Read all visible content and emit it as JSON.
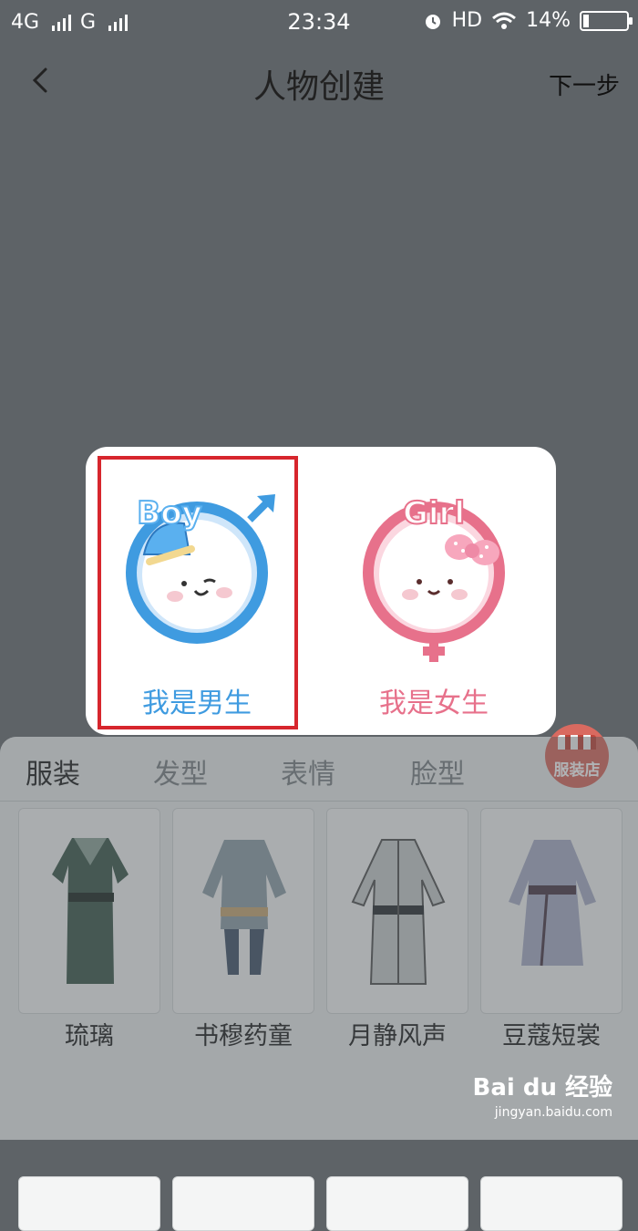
{
  "status_bar": {
    "network_1": "4G",
    "network_2": "G",
    "time": "23:34",
    "hd": "HD",
    "battery_percent": "14%",
    "battery_level": 0.14
  },
  "nav": {
    "back_icon": "chevron-left-icon",
    "title": "人物创建",
    "next_label": "下一步"
  },
  "gender_dialog": {
    "boy": {
      "badge": "Boy",
      "label": "我是男生",
      "color": "#3f9be0"
    },
    "girl": {
      "badge": "Girl",
      "label": "我是女生",
      "color": "#e7718b"
    }
  },
  "tabs": [
    "服装",
    "发型",
    "表情",
    "脸型"
  ],
  "shop": {
    "label": "服装店",
    "icon": "storefront-icon"
  },
  "outfits": [
    "琉璃",
    "书穆药童",
    "月静风声",
    "豆蔻短裳"
  ],
  "watermark": {
    "brand": "Bai du 经验",
    "url": "jingyan.baidu.com"
  }
}
